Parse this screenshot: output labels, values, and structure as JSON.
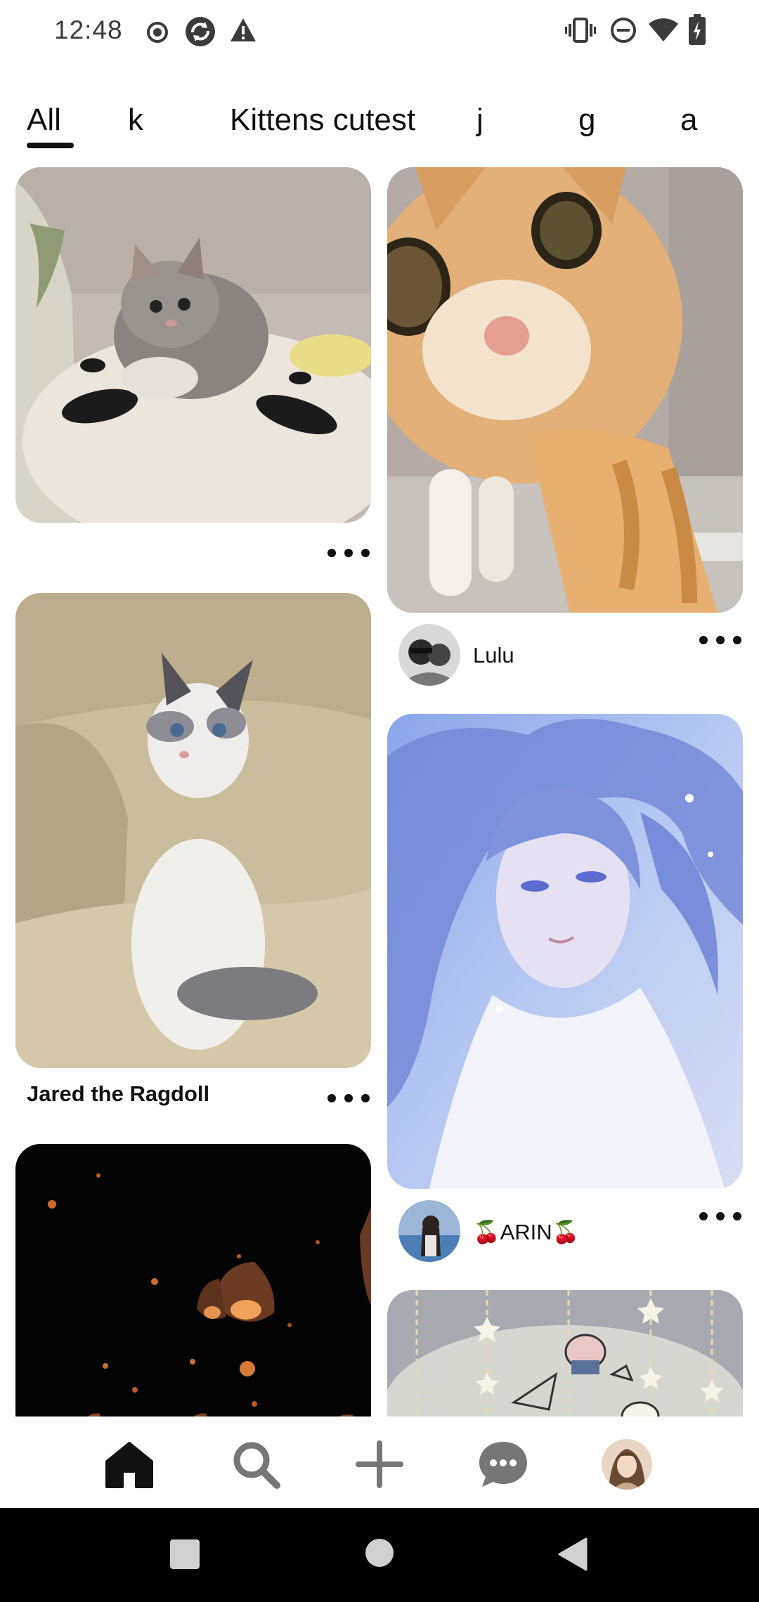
{
  "status_bar": {
    "time": "12:48",
    "left_icons": [
      "record-icon",
      "sync-icon",
      "warning-icon"
    ],
    "right_icons": [
      "vibrate-icon",
      "do-not-disturb-icon",
      "wifi-icon",
      "battery-charging-icon"
    ]
  },
  "tabs": [
    {
      "label": "All",
      "selected": true
    },
    {
      "label": "k",
      "selected": false
    },
    {
      "label": "Kittens cutest",
      "selected": false
    },
    {
      "label": "j",
      "selected": false
    },
    {
      "label": "g",
      "selected": false
    },
    {
      "label": "a",
      "selected": false
    }
  ],
  "feed": {
    "left": [
      {
        "image": "calico kitten on pillow",
        "caption": ""
      },
      {
        "image": "ragdoll kitten on couch",
        "caption": "Jared the Ragdoll"
      },
      {
        "image": "sky lanterns at night",
        "caption": ""
      }
    ],
    "right": [
      {
        "image": "orange cat close-up",
        "user": "Lulu"
      },
      {
        "image": "blue anime portrait",
        "user": "🍒ARIN🍒"
      },
      {
        "image": "hanging stars decoration",
        "user": ""
      }
    ]
  },
  "bottom_nav": {
    "items": [
      "home-icon",
      "search-icon",
      "create-icon",
      "messages-icon",
      "profile-avatar"
    ],
    "active": "home-icon"
  },
  "colors": {
    "text": "#111111",
    "background": "#ffffff",
    "system_nav": "#000000",
    "icon_gray": "#767676"
  }
}
